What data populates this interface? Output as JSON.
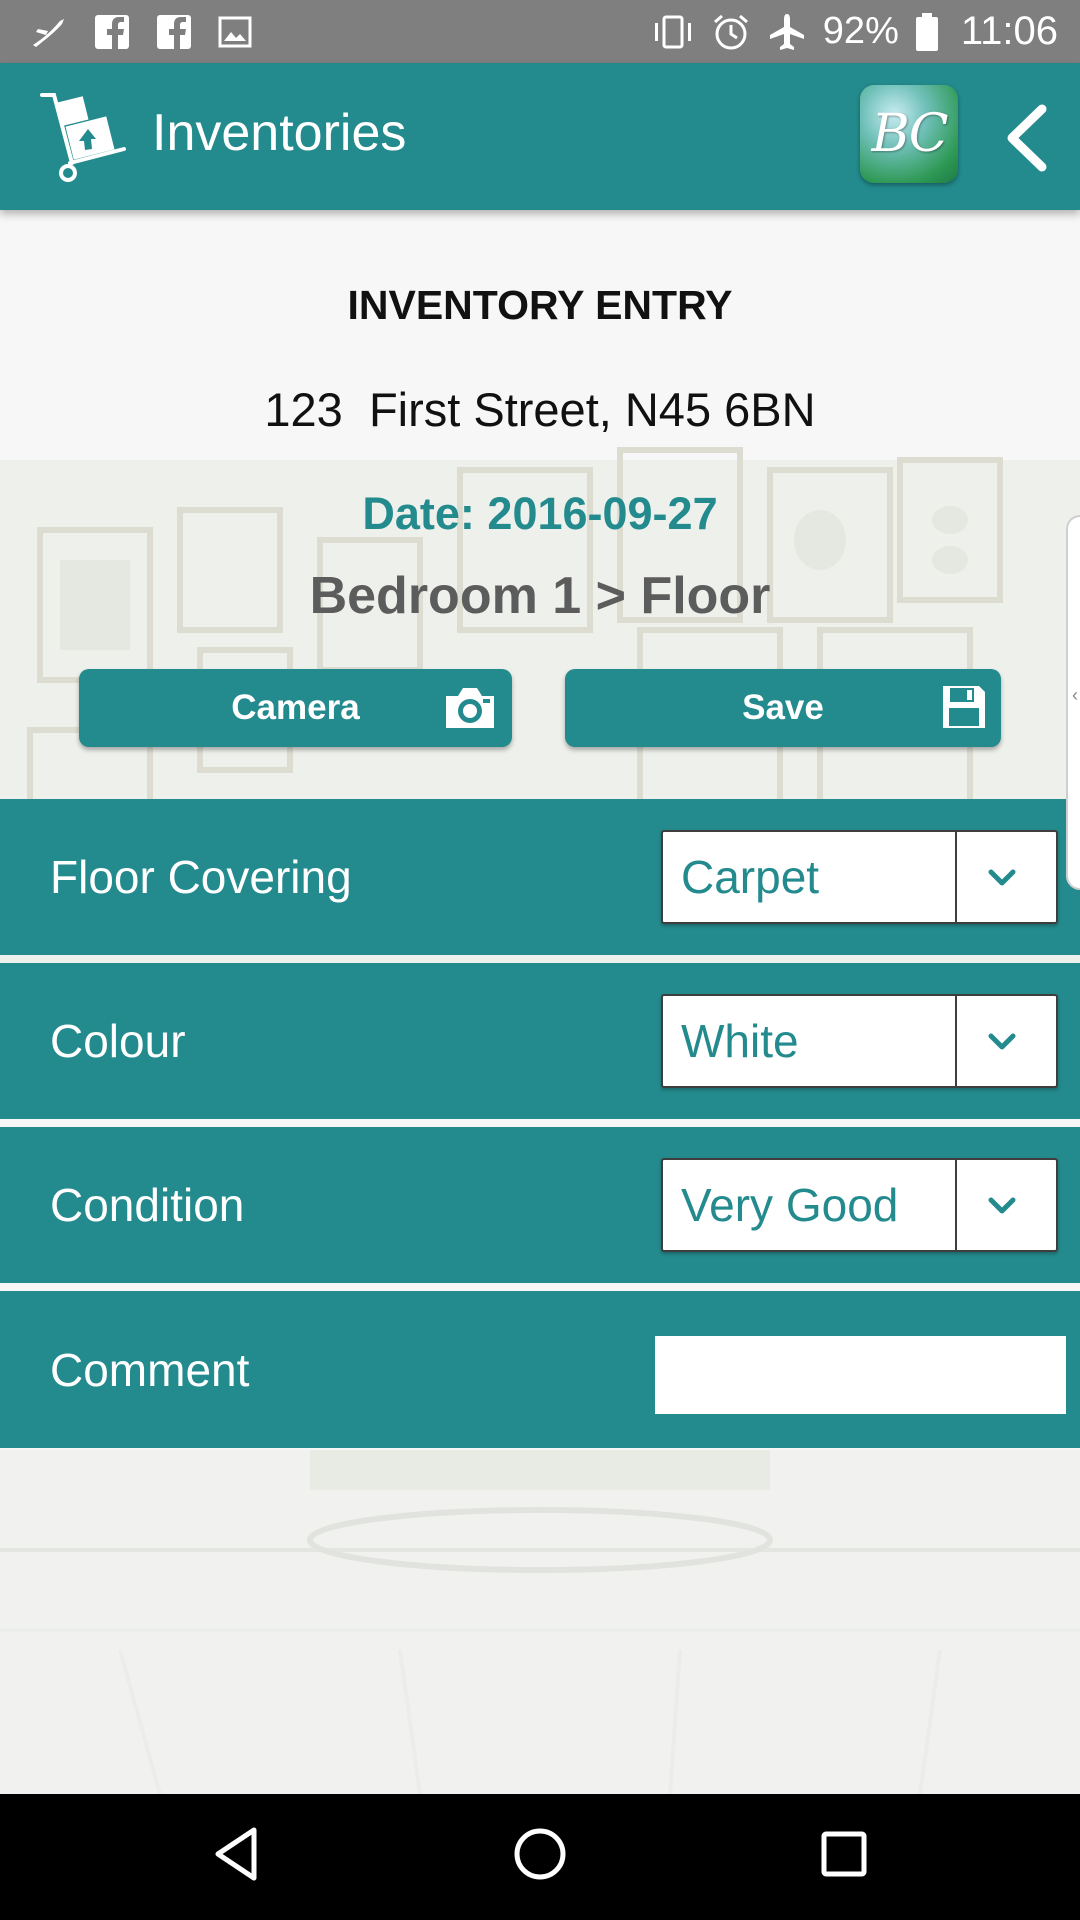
{
  "status_bar": {
    "icons": [
      "airplane-swoosh-icon",
      "facebook-icon",
      "facebook-icon",
      "gallery-icon",
      "vibrate-icon",
      "alarm-icon",
      "airplane-mode-icon",
      "battery-icon"
    ],
    "battery": "92%",
    "time": "11:06"
  },
  "header": {
    "title": "Inventories",
    "badge": "BC",
    "logo_icon": "hand-truck-boxes-icon",
    "back_icon": "chevron-left-icon",
    "background_color": "#238a8d"
  },
  "entry": {
    "heading": "INVENTORY ENTRY",
    "address": "123  First Street, N45 6BN",
    "date": "Date: 2016-09-27",
    "location": "Bedroom 1 > Floor"
  },
  "actions": {
    "camera_label": "Camera",
    "camera_icon": "camera-icon",
    "save_label": "Save",
    "save_icon": "floppy-disk-icon"
  },
  "form": {
    "floor_covering": {
      "label": "Floor Covering",
      "value": "Carpet"
    },
    "colour": {
      "label": "Colour",
      "value": "White"
    },
    "condition": {
      "label": "Condition",
      "value": "Very Good"
    },
    "comment": {
      "label": "Comment",
      "value": ""
    }
  },
  "side_tab": {
    "glyph": "‹"
  },
  "nav_bar": {
    "icons": [
      "back-triangle-icon",
      "home-circle-icon",
      "recents-square-icon"
    ]
  },
  "colors": {
    "accent": "#238a8d",
    "location_text": "#5c5c5c",
    "status_bar": "#7f7f7f"
  }
}
